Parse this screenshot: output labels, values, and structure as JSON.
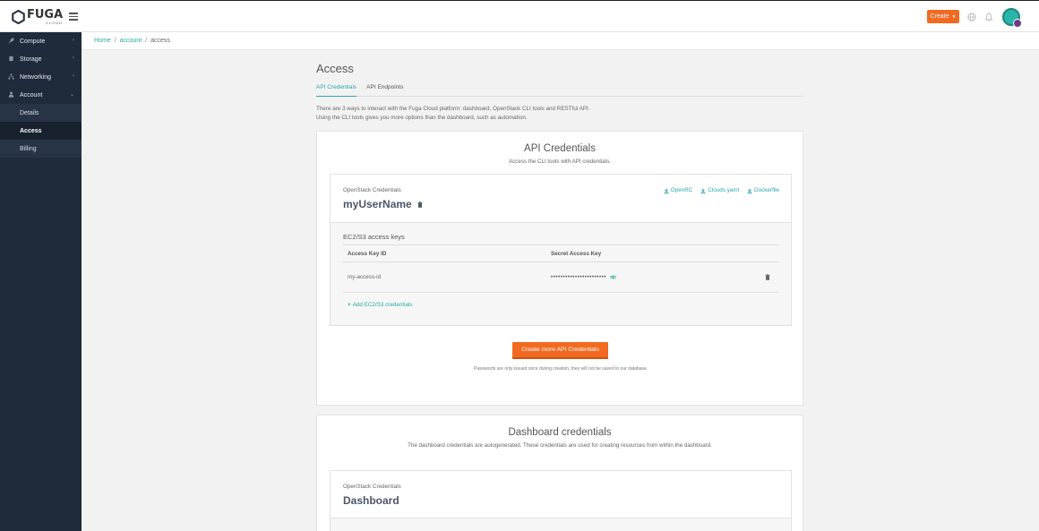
{
  "app": {
    "logo_text": "FUGA",
    "logo_sub": "CLOUD",
    "create_label": "Create"
  },
  "sidebar": {
    "items": [
      {
        "label": "Compute",
        "icon": "rocket-icon"
      },
      {
        "label": "Storage",
        "icon": "database-icon"
      },
      {
        "label": "Networking",
        "icon": "network-icon"
      },
      {
        "label": "Account",
        "icon": "user-icon"
      }
    ],
    "account_sub": [
      {
        "label": "Details"
      },
      {
        "label": "Access"
      },
      {
        "label": "Billing"
      }
    ]
  },
  "breadcrumb": {
    "home": "Home",
    "account": "account",
    "current": "access"
  },
  "page": {
    "title": "Access",
    "tabs": [
      "API Credentials",
      "API Endpoints"
    ],
    "intro_line1": "There are 3 ways to interact with the Fuga Cloud platform: dashboard, OpenStack CLI tools and RESTful API.",
    "intro_line2": "Using the CLI tools gives you more options than the dashboard, such as automation."
  },
  "api_card": {
    "title": "API Credentials",
    "subtitle": "Access the CLI tools with API credentials.",
    "oc_label": "OpenStack Credentials",
    "username": "myUserName",
    "downloads": [
      "OpenRC",
      "Clouds.yaml",
      "Dockerfile"
    ],
    "ec2_title": "EC2/S3 access keys",
    "table_headers": [
      "Access Key ID",
      "Secret Access Key"
    ],
    "rows": [
      {
        "access_key": "my-access-id",
        "secret": "•••••••••••••••••••••••"
      }
    ],
    "add_label": "Add EC2/S3 credentials",
    "cta_label": "Create more API Credentials",
    "note": "Passwords are only issued once during creation, they will not be saved to our database."
  },
  "dashboard_card": {
    "title": "Dashboard credentials",
    "subtitle": "The dashboard credentials are autogenerated. These credentials are used for creating resources from within the dashboard.",
    "oc_label": "OpenStack Credentials",
    "username": "Dashboard"
  },
  "colors": {
    "accent": "#2aa7a8",
    "brand_orange": "#f26a21",
    "sidebar_bg": "#1f2b3a"
  }
}
